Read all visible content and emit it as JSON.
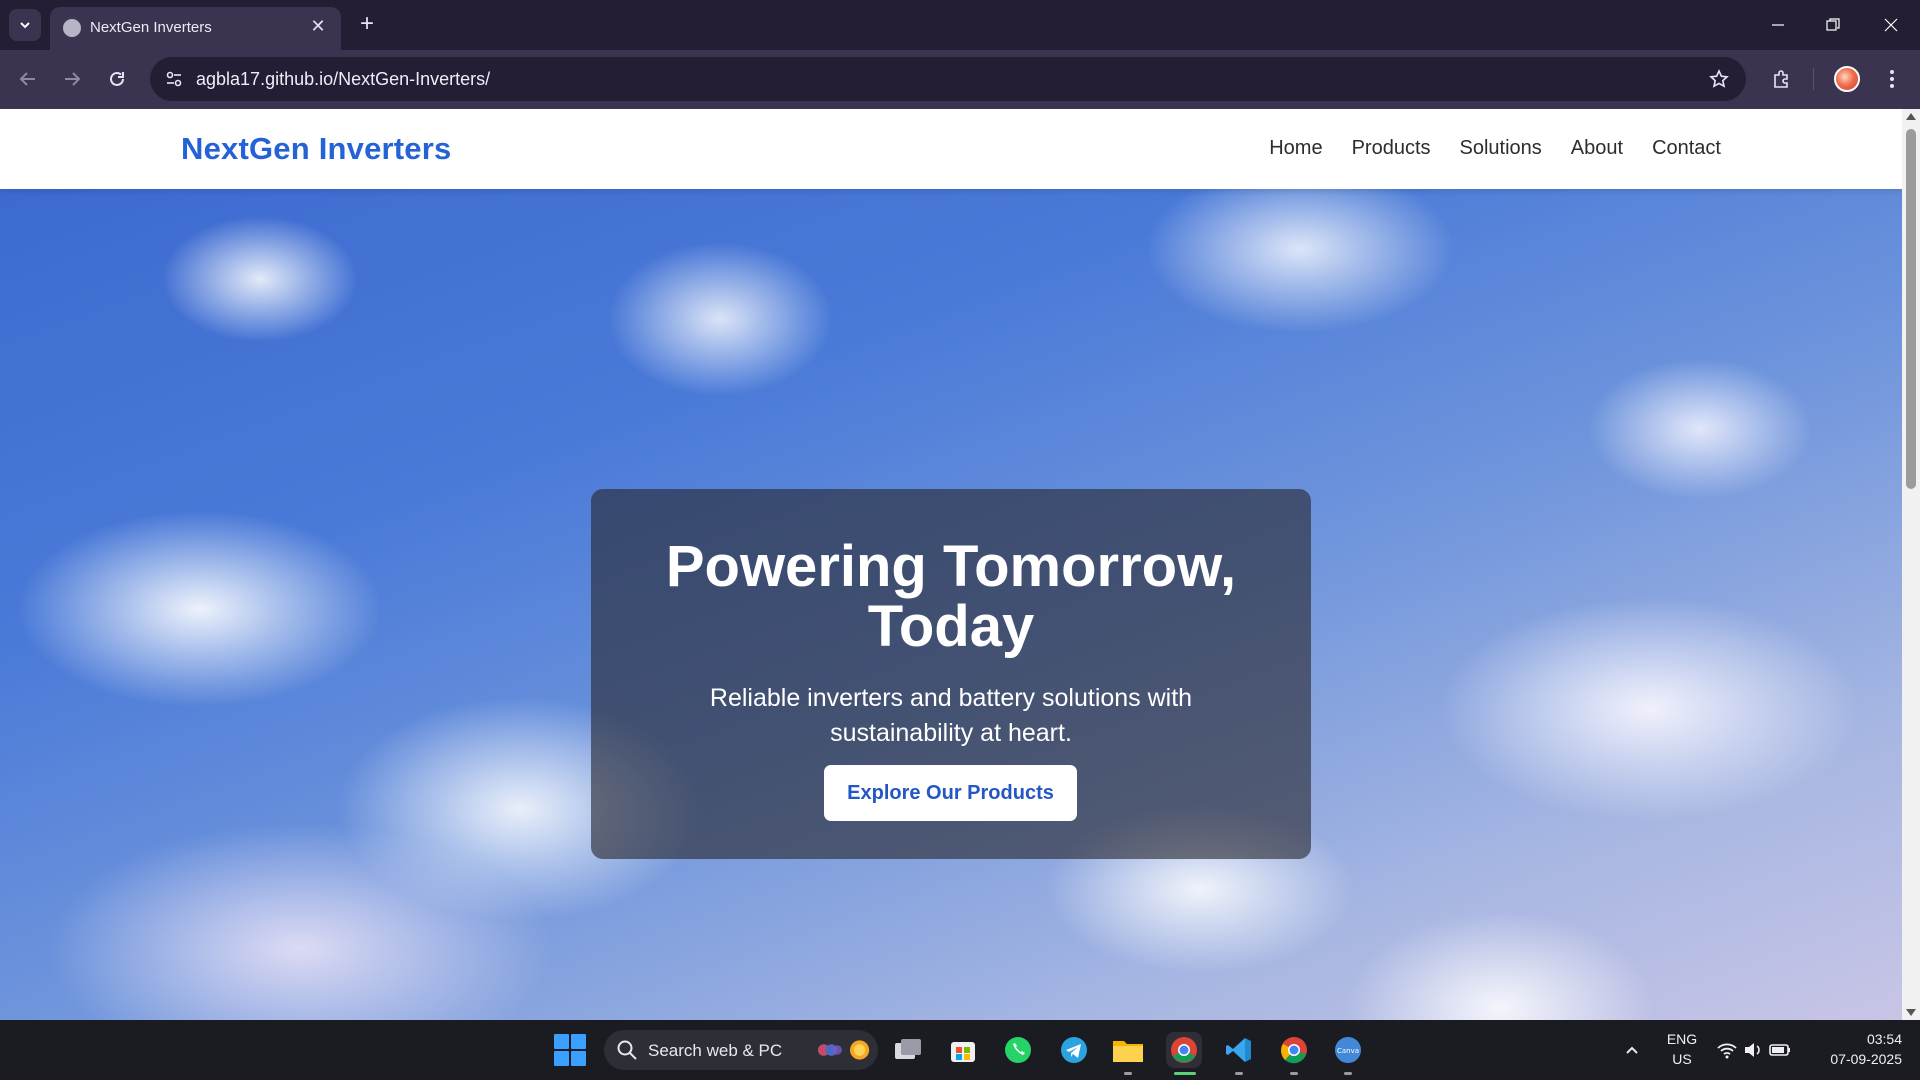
{
  "browser": {
    "tab_title": "NextGen Inverters",
    "url": "agbla17.github.io/NextGen-Inverters/"
  },
  "site": {
    "brand": "NextGen Inverters",
    "nav": [
      "Home",
      "Products",
      "Solutions",
      "About",
      "Contact"
    ],
    "hero": {
      "title": "Powering Tomorrow, Today",
      "subtitle": "Reliable inverters and battery solutions with sustainability at heart.",
      "cta": "Explore Our Products"
    }
  },
  "taskbar": {
    "search_placeholder": "Search web & PC",
    "language": "ENG",
    "region": "US",
    "time": "03:54",
    "date": "07-09-2025"
  },
  "colors": {
    "brand": "#2463d6",
    "chrome_dark": "#231e33",
    "chrome_toolbar": "#3a3450"
  }
}
